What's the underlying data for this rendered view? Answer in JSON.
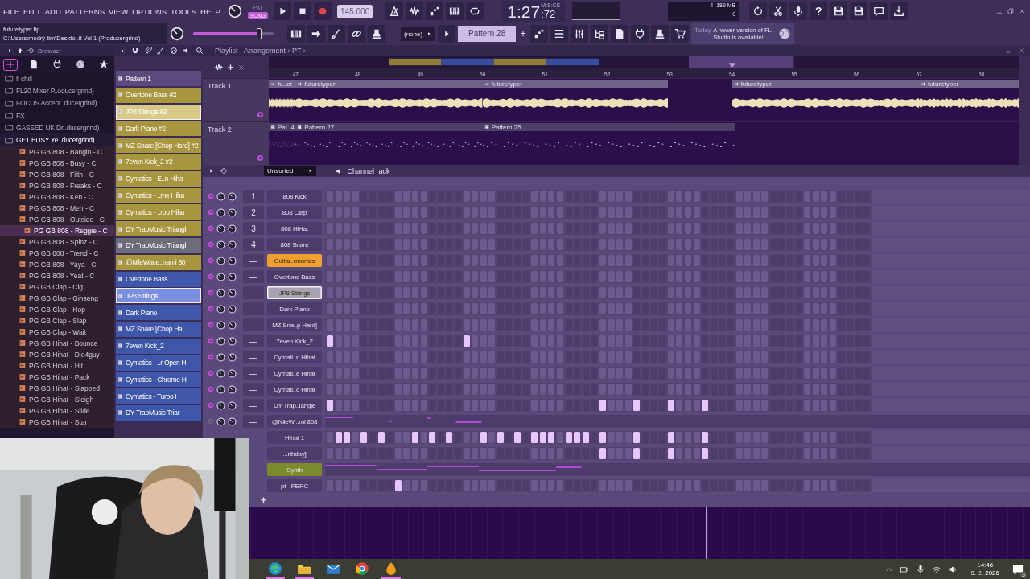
{
  "toolbar": {
    "menu": [
      "FILE",
      "EDIT",
      "ADD",
      "PATTERNS",
      "VIEW",
      "OPTIONS",
      "TOOLS",
      "HELP"
    ],
    "modes": [
      {
        "label": "PAT",
        "selected": false
      },
      {
        "label": "SONG",
        "selected": true
      }
    ],
    "tempo": "145.000",
    "time": {
      "main": "1:27",
      "fraction": ":72",
      "format": "M:S:CS"
    },
    "memory": {
      "voices": "4",
      "ram": "189 MB",
      "load": "0"
    },
    "help": "?",
    "project": {
      "file": "futuretyper.flp",
      "path": "C:\\Users\\modrý tim\\Deskto..it Vol 1 (Producergrind)"
    },
    "master_volume": {
      "level": 0.82
    },
    "preset": "(none)",
    "pattern": "Pattern 28",
    "pattern_add": "+",
    "news": {
      "date": "Today",
      "message": "A newer version of FL Studio is available!"
    }
  },
  "browser": {
    "title": "Browser",
    "tabs": [
      {
        "kind": "all",
        "selected": true
      },
      {
        "kind": "files",
        "selected": false
      },
      {
        "kind": "plugins",
        "selected": false
      },
      {
        "kind": "web",
        "selected": false
      },
      {
        "kind": "favorites",
        "selected": false
      }
    ],
    "folders": [
      {
        "name": "fl chill",
        "expanded": false
      },
      {
        "name": "FL20 Mixer P..oducergrind)",
        "expanded": false
      },
      {
        "name": "FOCUS Accent..ducergrind)",
        "expanded": false
      },
      {
        "name": "FX",
        "expanded": false
      },
      {
        "name": "GASSED UK Dr..ducergrind)",
        "expanded": false
      },
      {
        "name": "GET BUSY Ye..ducergrind)",
        "expanded": true,
        "children": [
          {
            "name": "PG GB 808 - Bangin - C",
            "selected": false
          },
          {
            "name": "PG GB 808 - Busy - C",
            "selected": false
          },
          {
            "name": "PG GB 808 - Filth - C",
            "selected": false
          },
          {
            "name": "PG GB 808 - Freaks - C",
            "selected": false
          },
          {
            "name": "PG GB 808 - Ken - C",
            "selected": false
          },
          {
            "name": "PG GB 808 - Meh - C",
            "selected": false
          },
          {
            "name": "PG GB 808 - Outside - C",
            "selected": false
          },
          {
            "name": "PG GB 808 - Reggie - C",
            "selected": true
          },
          {
            "name": "PG GB 808 - Spinz - C",
            "selected": false
          },
          {
            "name": "PG GB 808 - Trend - C",
            "selected": false
          },
          {
            "name": "PG GB 808 - Yaya - C",
            "selected": false
          },
          {
            "name": "PG GB 808 - Yeat - C",
            "selected": false
          },
          {
            "name": "PG GB Clap - Cig",
            "selected": false
          },
          {
            "name": "PG GB Clap - Ginseng",
            "selected": false
          },
          {
            "name": "PG GB Clap - Hop",
            "selected": false
          },
          {
            "name": "PG GB Clap - Slap",
            "selected": false
          },
          {
            "name": "PG GB Clap - Wait",
            "selected": false
          },
          {
            "name": "PG GB Hihat - Bounce",
            "selected": false
          },
          {
            "name": "PG GB Hihat - Die4guy",
            "selected": false
          },
          {
            "name": "PG GB Hihat - Hit",
            "selected": false
          },
          {
            "name": "PG GB Hihat - Pack",
            "selected": false
          },
          {
            "name": "PG GB Hihat - Slapped",
            "selected": false
          },
          {
            "name": "PG GB Hihat - Sleigh",
            "selected": false
          },
          {
            "name": "PG GB Hihat - Slide",
            "selected": false
          },
          {
            "name": "PG GB Hihat - Star",
            "selected": false
          }
        ]
      }
    ]
  },
  "patterns": [
    {
      "name": "Pattern 1",
      "color": "#5b4a7e",
      "selected": false
    },
    {
      "name": "Overtone Bass #2",
      "color": "#a8963f",
      "selected": false
    },
    {
      "name": "JP8 Strings #2",
      "color": "#d8ca86",
      "selected": true
    },
    {
      "name": "Dark Piano #2",
      "color": "#a8963f",
      "selected": false
    },
    {
      "name": "MZ Snare [Chop Hard] #2",
      "color": "#a8963f",
      "selected": false
    },
    {
      "name": "7even Kick_2 #2",
      "color": "#a8963f",
      "selected": false
    },
    {
      "name": "Cymatics - E..n Hiha",
      "color": "#a8963f",
      "selected": false
    },
    {
      "name": "Cymatics - ..me Hiha",
      "color": "#a8963f",
      "selected": false
    },
    {
      "name": "Cymatics - ..rbo Hiha",
      "color": "#a8963f",
      "selected": false
    },
    {
      "name": "DY  TrapMusic Triangl",
      "color": "#a8963f",
      "selected": false
    },
    {
      "name": "DY  TrapMusic Triangl",
      "color": "#6f6c7a",
      "selected": false
    },
    {
      "name": "@NileWave..nami 80",
      "color": "#a8963f",
      "selected": false
    },
    {
      "name": "Overtone Bass",
      "color": "#3f57a8",
      "selected": false
    },
    {
      "name": "JP8 Strings",
      "color": "#7b8fe0",
      "selected": true
    },
    {
      "name": "Dark Piano",
      "color": "#3f57a8",
      "selected": false
    },
    {
      "name": "MZ Snare [Chop Ha",
      "color": "#3f57a8",
      "selected": false
    },
    {
      "name": "7even Kick_2",
      "color": "#3f57a8",
      "selected": false
    },
    {
      "name": "Cymatics - ..r Open H",
      "color": "#3f57a8",
      "selected": false
    },
    {
      "name": "Cymatics - Chrome H",
      "color": "#3f57a8",
      "selected": false
    },
    {
      "name": "Cymatics - Turbo H",
      "color": "#3f57a8",
      "selected": false
    },
    {
      "name": "DY  TrapMusic Triar",
      "color": "#3f57a8",
      "selected": false
    }
  ],
  "playlist": {
    "title": "Playlist - Arrangement › PT ›",
    "add": "+",
    "bars": [
      "47",
      "48",
      "49",
      "50",
      "51",
      "52",
      "53",
      "54",
      "55",
      "56",
      "57",
      "58"
    ],
    "tracks": [
      {
        "name": "Track 1",
        "kind": "audio",
        "clips": [
          {
            "name": "fu..er"
          },
          {
            "name": "futuretyper"
          },
          {
            "name": "futuretyper"
          },
          {
            "name": "futuretyper"
          },
          {
            "name": "futuretyper"
          }
        ]
      },
      {
        "name": "Track 2",
        "kind": "pattern",
        "clips": [
          {
            "name": "Pat..4"
          },
          {
            "name": "Pattern 27"
          },
          {
            "name": "Pattern 25"
          }
        ]
      }
    ]
  },
  "channel_rack": {
    "title": "Channel rack",
    "filter": "Unsorted",
    "add": "+",
    "channels": [
      {
        "number": "1",
        "name": "808 Kick",
        "color": "#4b3c6b",
        "selected": false,
        "muted": false,
        "kind": "steps",
        "steps": [
          false,
          false,
          false,
          false,
          false,
          false,
          false,
          false,
          false,
          false,
          false,
          false,
          false,
          false,
          false,
          false,
          false,
          false,
          false,
          false,
          false,
          false,
          false,
          false,
          false,
          false,
          false,
          false,
          false,
          false,
          false,
          false,
          false,
          false,
          false,
          false,
          false,
          false,
          false,
          false,
          false,
          false,
          false,
          false,
          false,
          false,
          false,
          false,
          false,
          false,
          false,
          false,
          false,
          false,
          false,
          false,
          false,
          false,
          false,
          false,
          false,
          false,
          false,
          false
        ]
      },
      {
        "number": "2",
        "name": "808 Clap",
        "color": "#4b3c6b",
        "selected": false,
        "muted": false,
        "kind": "steps",
        "steps": [
          false,
          false,
          false,
          false,
          false,
          false,
          false,
          false,
          false,
          false,
          false,
          false,
          false,
          false,
          false,
          false,
          false,
          false,
          false,
          false,
          false,
          false,
          false,
          false,
          false,
          false,
          false,
          false,
          false,
          false,
          false,
          false,
          false,
          false,
          false,
          false,
          false,
          false,
          false,
          false,
          false,
          false,
          false,
          false,
          false,
          false,
          false,
          false,
          false,
          false,
          false,
          false,
          false,
          false,
          false,
          false,
          false,
          false,
          false,
          false,
          false,
          false,
          false,
          false
        ]
      },
      {
        "number": "3",
        "name": "808 HiHat",
        "color": "#4b3c6b",
        "selected": false,
        "muted": false,
        "kind": "steps",
        "steps": [
          false,
          false,
          false,
          false,
          false,
          false,
          false,
          false,
          false,
          false,
          false,
          false,
          false,
          false,
          false,
          false,
          false,
          false,
          false,
          false,
          false,
          false,
          false,
          false,
          false,
          false,
          false,
          false,
          false,
          false,
          false,
          false,
          false,
          false,
          false,
          false,
          false,
          false,
          false,
          false,
          false,
          false,
          false,
          false,
          false,
          false,
          false,
          false,
          false,
          false,
          false,
          false,
          false,
          false,
          false,
          false,
          false,
          false,
          false,
          false,
          false,
          false,
          false,
          false
        ]
      },
      {
        "number": "4",
        "name": "808 Snare",
        "color": "#4b3c6b",
        "selected": false,
        "muted": false,
        "kind": "steps",
        "steps": [
          false,
          false,
          false,
          false,
          false,
          false,
          false,
          false,
          false,
          false,
          false,
          false,
          false,
          false,
          false,
          false,
          false,
          false,
          false,
          false,
          false,
          false,
          false,
          false,
          false,
          false,
          false,
          false,
          false,
          false,
          false,
          false,
          false,
          false,
          false,
          false,
          false,
          false,
          false,
          false,
          false,
          false,
          false,
          false,
          false,
          false,
          false,
          false,
          false,
          false,
          false,
          false,
          false,
          false,
          false,
          false,
          false,
          false,
          false,
          false,
          false,
          false,
          false,
          false
        ]
      },
      {
        "number": "—",
        "name": "Guitar..rmonics",
        "color": "#f0a02e",
        "selected": false,
        "muted": false,
        "kind": "steps",
        "steps": [
          false,
          false,
          false,
          false,
          false,
          false,
          false,
          false,
          false,
          false,
          false,
          false,
          false,
          false,
          false,
          false,
          false,
          false,
          false,
          false,
          false,
          false,
          false,
          false,
          false,
          false,
          false,
          false,
          false,
          false,
          false,
          false,
          false,
          false,
          false,
          false,
          false,
          false,
          false,
          false,
          false,
          false,
          false,
          false,
          false,
          false,
          false,
          false,
          false,
          false,
          false,
          false,
          false,
          false,
          false,
          false,
          false,
          false,
          false,
          false,
          false,
          false,
          false,
          false
        ]
      },
      {
        "number": "—",
        "name": "Overtone Bass",
        "color": "#4b3c6b",
        "selected": false,
        "muted": false,
        "kind": "steps",
        "steps": [
          false,
          false,
          false,
          false,
          false,
          false,
          false,
          false,
          false,
          false,
          false,
          false,
          false,
          false,
          false,
          false,
          false,
          false,
          false,
          false,
          false,
          false,
          false,
          false,
          false,
          false,
          false,
          false,
          false,
          false,
          false,
          false,
          false,
          false,
          false,
          false,
          false,
          false,
          false,
          false,
          false,
          false,
          false,
          false,
          false,
          false,
          false,
          false,
          false,
          false,
          false,
          false,
          false,
          false,
          false,
          false,
          false,
          false,
          false,
          false,
          false,
          false,
          false,
          false
        ]
      },
      {
        "number": "—",
        "name": "JP8 Strings",
        "color": "#a7a3b3",
        "selected": true,
        "muted": false,
        "kind": "steps",
        "steps": [
          false,
          false,
          false,
          false,
          false,
          false,
          false,
          false,
          false,
          false,
          false,
          false,
          false,
          false,
          false,
          false,
          false,
          false,
          false,
          false,
          false,
          false,
          false,
          false,
          false,
          false,
          false,
          false,
          false,
          false,
          false,
          false,
          false,
          false,
          false,
          false,
          false,
          false,
          false,
          false,
          false,
          false,
          false,
          false,
          false,
          false,
          false,
          false,
          false,
          false,
          false,
          false,
          false,
          false,
          false,
          false,
          false,
          false,
          false,
          false,
          false,
          false,
          false,
          false
        ]
      },
      {
        "number": "—",
        "name": "Dark Piano",
        "color": "#4b3c6b",
        "selected": false,
        "muted": false,
        "kind": "steps",
        "steps": [
          false,
          false,
          false,
          false,
          false,
          false,
          false,
          false,
          false,
          false,
          false,
          false,
          false,
          false,
          false,
          false,
          false,
          false,
          false,
          false,
          false,
          false,
          false,
          false,
          false,
          false,
          false,
          false,
          false,
          false,
          false,
          false,
          false,
          false,
          false,
          false,
          false,
          false,
          false,
          false,
          false,
          false,
          false,
          false,
          false,
          false,
          false,
          false,
          false,
          false,
          false,
          false,
          false,
          false,
          false,
          false,
          false,
          false,
          false,
          false,
          false,
          false,
          false,
          false
        ]
      },
      {
        "number": "—",
        "name": "MZ Sna..p Hard]",
        "color": "#4b3c6b",
        "selected": false,
        "muted": false,
        "kind": "steps",
        "steps": [
          false,
          false,
          false,
          false,
          false,
          false,
          false,
          false,
          false,
          false,
          false,
          false,
          false,
          false,
          false,
          false,
          false,
          false,
          false,
          false,
          false,
          false,
          false,
          false,
          false,
          false,
          false,
          false,
          false,
          false,
          false,
          false,
          false,
          false,
          false,
          false,
          false,
          false,
          false,
          false,
          false,
          false,
          false,
          false,
          false,
          false,
          false,
          false,
          false,
          false,
          false,
          false,
          false,
          false,
          false,
          false,
          false,
          false,
          false,
          false,
          false,
          false,
          false,
          false
        ]
      },
      {
        "number": "—",
        "name": "7even Kick_2",
        "color": "#4b3c6b",
        "selected": false,
        "muted": false,
        "kind": "steps",
        "steps": [
          true,
          false,
          false,
          false,
          false,
          false,
          false,
          false,
          false,
          false,
          false,
          false,
          false,
          false,
          false,
          false,
          true,
          false,
          false,
          false,
          false,
          false,
          false,
          false,
          false,
          false,
          false,
          false,
          false,
          false,
          false,
          false,
          false,
          false,
          false,
          false,
          false,
          false,
          false,
          false,
          false,
          false,
          false,
          false,
          false,
          false,
          false,
          false,
          false,
          false,
          false,
          false,
          false,
          false,
          false,
          false,
          false,
          false,
          false,
          false,
          false,
          false,
          false,
          false
        ]
      },
      {
        "number": "—",
        "name": "Cymati..n Hihat",
        "color": "#4b3c6b",
        "selected": false,
        "muted": false,
        "kind": "steps",
        "steps": [
          false,
          false,
          false,
          false,
          false,
          false,
          false,
          false,
          false,
          false,
          false,
          false,
          false,
          false,
          false,
          false,
          false,
          false,
          false,
          false,
          false,
          false,
          false,
          false,
          false,
          false,
          false,
          false,
          false,
          false,
          false,
          false,
          false,
          false,
          false,
          false,
          false,
          false,
          false,
          false,
          false,
          false,
          false,
          false,
          false,
          false,
          false,
          false,
          false,
          false,
          false,
          false,
          false,
          false,
          false,
          false,
          false,
          false,
          false,
          false,
          false,
          false,
          false,
          false
        ]
      },
      {
        "number": "—",
        "name": "Cymati..e Hihat",
        "color": "#4b3c6b",
        "selected": false,
        "muted": false,
        "kind": "steps",
        "steps": [
          false,
          false,
          false,
          false,
          false,
          false,
          false,
          false,
          false,
          false,
          false,
          false,
          false,
          false,
          false,
          false,
          false,
          false,
          false,
          false,
          false,
          false,
          false,
          false,
          false,
          false,
          false,
          false,
          false,
          false,
          false,
          false,
          false,
          false,
          false,
          false,
          false,
          false,
          false,
          false,
          false,
          false,
          false,
          false,
          false,
          false,
          false,
          false,
          false,
          false,
          false,
          false,
          false,
          false,
          false,
          false,
          false,
          false,
          false,
          false,
          false,
          false,
          false,
          false
        ]
      },
      {
        "number": "—",
        "name": "Cymati..o Hihat",
        "color": "#4b3c6b",
        "selected": false,
        "muted": false,
        "kind": "steps",
        "steps": [
          false,
          false,
          false,
          false,
          false,
          false,
          false,
          false,
          false,
          false,
          false,
          false,
          false,
          false,
          false,
          false,
          false,
          false,
          false,
          false,
          false,
          false,
          false,
          false,
          false,
          false,
          false,
          false,
          false,
          false,
          false,
          false,
          false,
          false,
          false,
          false,
          false,
          false,
          false,
          false,
          false,
          false,
          false,
          false,
          false,
          false,
          false,
          false,
          false,
          false,
          false,
          false,
          false,
          false,
          false,
          false,
          false,
          false,
          false,
          false,
          false,
          false,
          false,
          false
        ]
      },
      {
        "number": "—",
        "name": "DY  Trap..iangle",
        "color": "#4b3c6b",
        "selected": false,
        "muted": false,
        "kind": "steps",
        "steps": [
          true,
          false,
          false,
          false,
          false,
          false,
          false,
          false,
          false,
          false,
          false,
          false,
          false,
          false,
          false,
          false,
          false,
          false,
          false,
          false,
          false,
          false,
          false,
          false,
          false,
          false,
          false,
          false,
          false,
          false,
          false,
          false,
          true,
          false,
          false,
          false,
          true,
          false,
          false,
          false,
          true,
          false,
          false,
          false,
          true,
          false,
          false,
          false,
          false,
          false,
          false,
          false,
          false,
          false,
          false,
          false,
          false,
          false,
          false,
          false,
          false,
          false,
          false,
          false
        ]
      },
      {
        "number": "—",
        "name": "@NileW...mi 808",
        "color": "#4b3c6b",
        "selected": false,
        "muted": true,
        "kind": "pianoroll"
      },
      {
        "name": "Hihat 1",
        "color": "#4b3c6b",
        "selected": false,
        "kind": "steps",
        "steps": [
          false,
          true,
          true,
          false,
          true,
          false,
          true,
          false,
          false,
          false,
          true,
          false,
          true,
          false,
          true,
          false,
          false,
          false,
          true,
          false,
          true,
          false,
          true,
          false,
          true,
          true,
          true,
          false,
          true,
          true,
          true,
          false,
          true,
          false,
          false,
          false,
          true,
          false,
          false,
          false,
          true,
          false,
          false,
          false,
          true,
          false,
          false,
          false,
          false,
          false,
          false,
          false,
          false,
          false,
          false,
          false,
          false,
          false,
          false,
          false,
          false,
          false,
          false,
          false
        ]
      },
      {
        "name": "...rthday]",
        "color": "#4b3c6b",
        "selected": false,
        "kind": "steps",
        "steps": [
          false,
          false,
          false,
          false,
          false,
          false,
          false,
          false,
          false,
          false,
          false,
          false,
          false,
          false,
          false,
          false,
          false,
          false,
          false,
          false,
          false,
          false,
          false,
          false,
          false,
          false,
          false,
          false,
          false,
          false,
          false,
          false,
          true,
          false,
          false,
          false,
          true,
          false,
          false,
          false,
          true,
          false,
          false,
          false,
          true,
          false,
          false,
          false,
          false,
          false,
          false,
          false,
          false,
          false,
          false,
          false,
          false,
          false,
          false,
          false,
          false,
          false,
          false,
          false
        ]
      },
      {
        "name": "Synth",
        "color": "#7d8a2c",
        "selected": false,
        "kind": "pianoroll"
      },
      {
        "name": "pt - PERC",
        "color": "#4b3c6b",
        "selected": false,
        "kind": "steps",
        "steps": [
          false,
          false,
          false,
          false,
          false,
          false,
          false,
          false,
          true,
          false,
          false,
          false,
          false,
          false,
          false,
          false,
          false,
          false,
          false,
          false,
          false,
          false,
          false,
          false,
          false,
          false,
          false,
          false,
          false,
          false,
          false,
          false,
          false,
          false,
          false,
          false,
          false,
          false,
          false,
          false,
          false,
          false,
          false,
          false,
          false,
          false,
          false,
          false,
          false,
          false,
          false,
          false,
          false,
          false,
          false,
          false,
          false,
          false,
          false,
          false,
          false,
          false,
          false,
          false
        ]
      }
    ]
  },
  "taskbar": {
    "apps": [
      {
        "kind": "edge",
        "active": true
      },
      {
        "kind": "files",
        "active": true
      },
      {
        "kind": "mail",
        "active": false
      },
      {
        "kind": "chrome",
        "active": false
      },
      {
        "kind": "fl",
        "active": true
      }
    ],
    "time": "14:46",
    "date": "9. 2. 2026",
    "notifications": "3"
  }
}
